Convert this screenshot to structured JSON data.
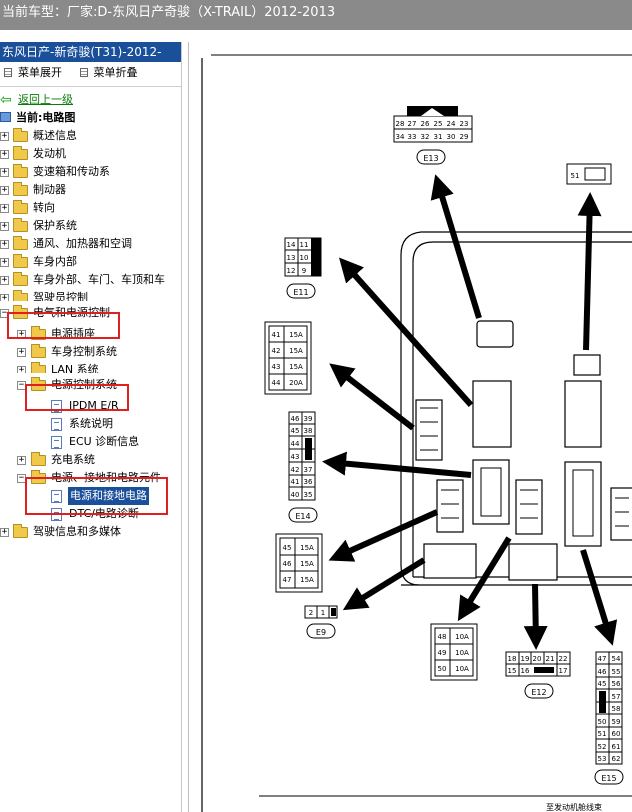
{
  "window": {
    "title": "当前车型：厂家:D-东风日产奇骏（X-TRAIL）2012-2013"
  },
  "sidebar": {
    "header": "东风日产-新奇骏(T31)-2012-",
    "toolbar": {
      "expand_label": "菜单展开",
      "collapse_label": "菜单折叠"
    },
    "back_label": "返回上一级",
    "current_label": "当前:电路图",
    "tree": [
      {
        "label": "概述信息"
      },
      {
        "label": "发动机"
      },
      {
        "label": "变速箱和传动系"
      },
      {
        "label": "制动器"
      },
      {
        "label": "转向"
      },
      {
        "label": "保护系统"
      },
      {
        "label": "通风、加热器和空调"
      },
      {
        "label": "车身内部"
      },
      {
        "label": "车身外部、车门、车顶和车"
      },
      {
        "label": "驾驶员控制"
      },
      {
        "label": "电气和电源控制"
      },
      {
        "label": "电源插座"
      },
      {
        "label": "车身控制系统"
      },
      {
        "label": "LAN 系统"
      },
      {
        "label": "电源控制系统"
      },
      {
        "label": "IPDM E/R"
      },
      {
        "label": "系统说明"
      },
      {
        "label": "ECU 诊断信息"
      },
      {
        "label": "充电系统"
      },
      {
        "label": "电源、接地和电路元件"
      },
      {
        "label": "电源和接地电路"
      },
      {
        "label": "DTC/电路诊断"
      },
      {
        "label": "驾驶信息和多媒体"
      }
    ]
  },
  "diagram": {
    "connectors": {
      "E13": {
        "id": "E13",
        "top_pins": [
          "28",
          "27",
          "26",
          "25",
          "24",
          "23"
        ],
        "bottom_pins": [
          "34",
          "33",
          "32",
          "31",
          "30",
          "29"
        ]
      },
      "E11": {
        "id": "E11",
        "pins": [
          "14",
          "11",
          "13",
          "10",
          "12",
          "9"
        ]
      },
      "pin51": "51",
      "fuses_a": {
        "pins": [
          "41",
          "42",
          "43",
          "44"
        ],
        "ratings": [
          "15A",
          "15A",
          "15A",
          "20A"
        ]
      },
      "E14": {
        "id": "E14",
        "left": [
          "46",
          "45",
          "44",
          "43",
          "42",
          "41",
          "40"
        ],
        "right": [
          "39",
          "38",
          "",
          "37",
          "36",
          "35"
        ]
      },
      "fuses_b": {
        "pins": [
          "45",
          "46",
          "47"
        ],
        "ratings": [
          "15A",
          "15A",
          "15A"
        ]
      },
      "E9": {
        "id": "E9",
        "pins": [
          "2",
          "1"
        ]
      },
      "fuses_c": {
        "pins": [
          "48",
          "49",
          "50"
        ],
        "ratings": [
          "10A",
          "10A",
          "10A"
        ]
      },
      "E12": {
        "id": "E12",
        "top_pins": [
          "18",
          "19",
          "20",
          "21",
          "22"
        ],
        "bottom_pins": [
          "15",
          "16",
          "17"
        ]
      },
      "E15": {
        "id": "E15",
        "left": [
          "47",
          "46",
          "45",
          "",
          "",
          "50",
          "51",
          "52",
          "53"
        ],
        "right": [
          "54",
          "55",
          "56",
          "57",
          "58",
          "59",
          "60",
          "61",
          "62"
        ]
      }
    },
    "footer": "至发动机舱线束"
  }
}
